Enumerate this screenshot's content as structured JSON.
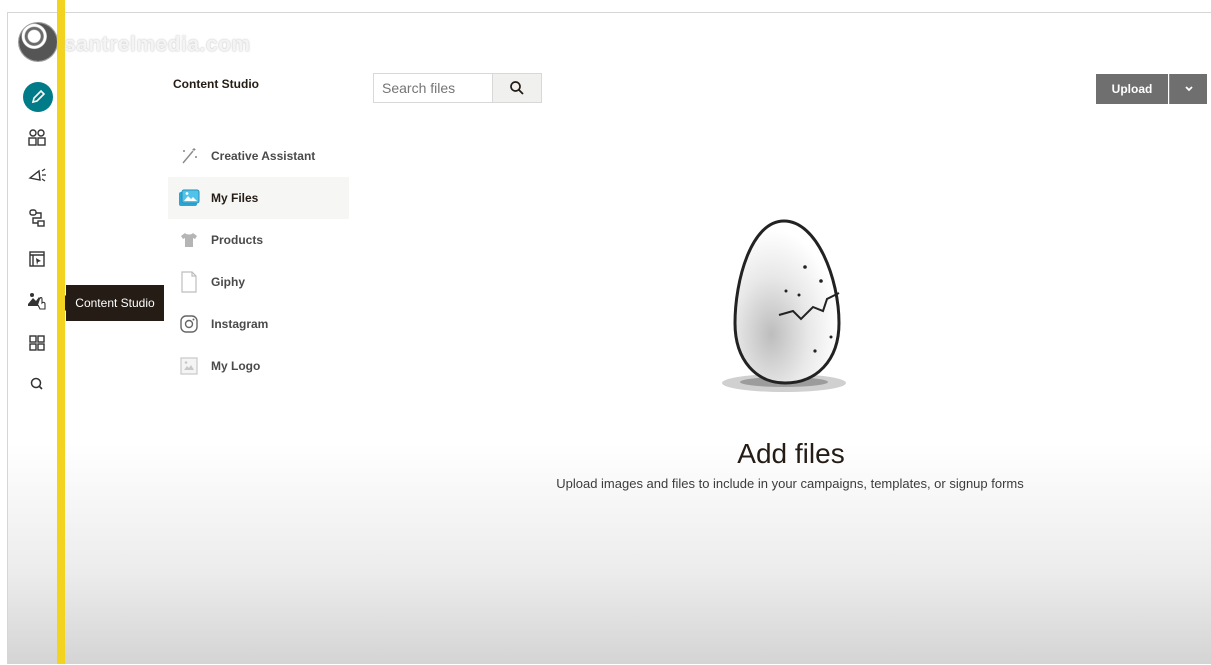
{
  "watermark": "santrelmedia.com",
  "rail": {
    "icons": [
      "create-icon",
      "audience-icon",
      "campaigns-icon",
      "automations-icon",
      "website-icon",
      "content-studio-icon",
      "integrations-icon",
      "search-icon"
    ]
  },
  "tooltip": {
    "text": "Content Studio"
  },
  "sidebar": {
    "title": "Content Studio",
    "items": [
      {
        "label": "Creative Assistant",
        "icon": "magic-wand-icon"
      },
      {
        "label": "My Files",
        "icon": "photos-icon",
        "active": true
      },
      {
        "label": "Products",
        "icon": "tshirt-icon"
      },
      {
        "label": "Giphy",
        "icon": "document-icon"
      },
      {
        "label": "Instagram",
        "icon": "instagram-icon"
      },
      {
        "label": "My Logo",
        "icon": "logo-image-icon"
      }
    ]
  },
  "search": {
    "placeholder": "Search files"
  },
  "upload": {
    "label": "Upload"
  },
  "empty_state": {
    "title": "Add files",
    "subtitle": "Upload images and files to include in your campaigns, templates, or signup forms"
  },
  "colors": {
    "accent": "#007c89",
    "highlight_bar": "#f2d31f",
    "upload_button": "#6f6f6f"
  }
}
